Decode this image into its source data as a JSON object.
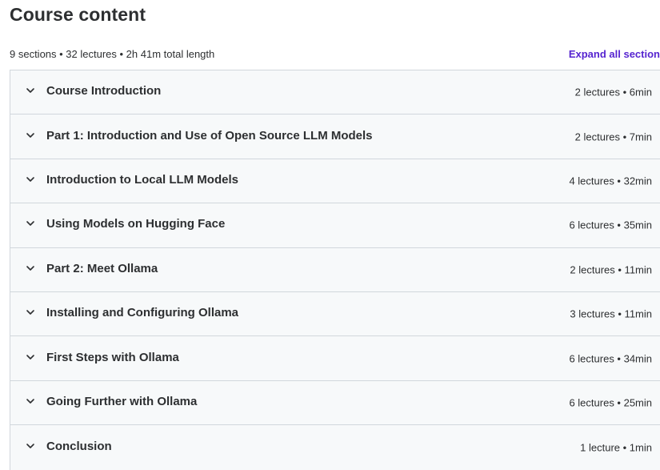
{
  "header": {
    "title": "Course content"
  },
  "summary": {
    "text": "9 sections • 32 lectures • 2h 41m total length",
    "expand_label": "Expand all section"
  },
  "sections": [
    {
      "title": "Course Introduction",
      "meta": "2 lectures • 6min"
    },
    {
      "title": "Part 1: Introduction and Use of Open Source LLM Models",
      "meta": "2 lectures • 7min"
    },
    {
      "title": "Introduction to Local LLM Models",
      "meta": "4 lectures • 32min"
    },
    {
      "title": "Using Models on Hugging Face",
      "meta": "6 lectures • 35min"
    },
    {
      "title": "Part 2: Meet Ollama",
      "meta": "2 lectures • 11min"
    },
    {
      "title": "Installing and Configuring Ollama",
      "meta": "3 lectures • 11min"
    },
    {
      "title": "First Steps with Ollama",
      "meta": "6 lectures • 34min"
    },
    {
      "title": "Going Further with Ollama",
      "meta": "6 lectures • 25min"
    },
    {
      "title": "Conclusion",
      "meta": "1 lecture • 1min"
    }
  ],
  "icons": {
    "section_toggle": "chevron-down-icon"
  },
  "colors": {
    "accent": "#5624d0",
    "text": "#2d2f31",
    "row_background": "#f7f9fa",
    "border": "#d1d7dc"
  }
}
